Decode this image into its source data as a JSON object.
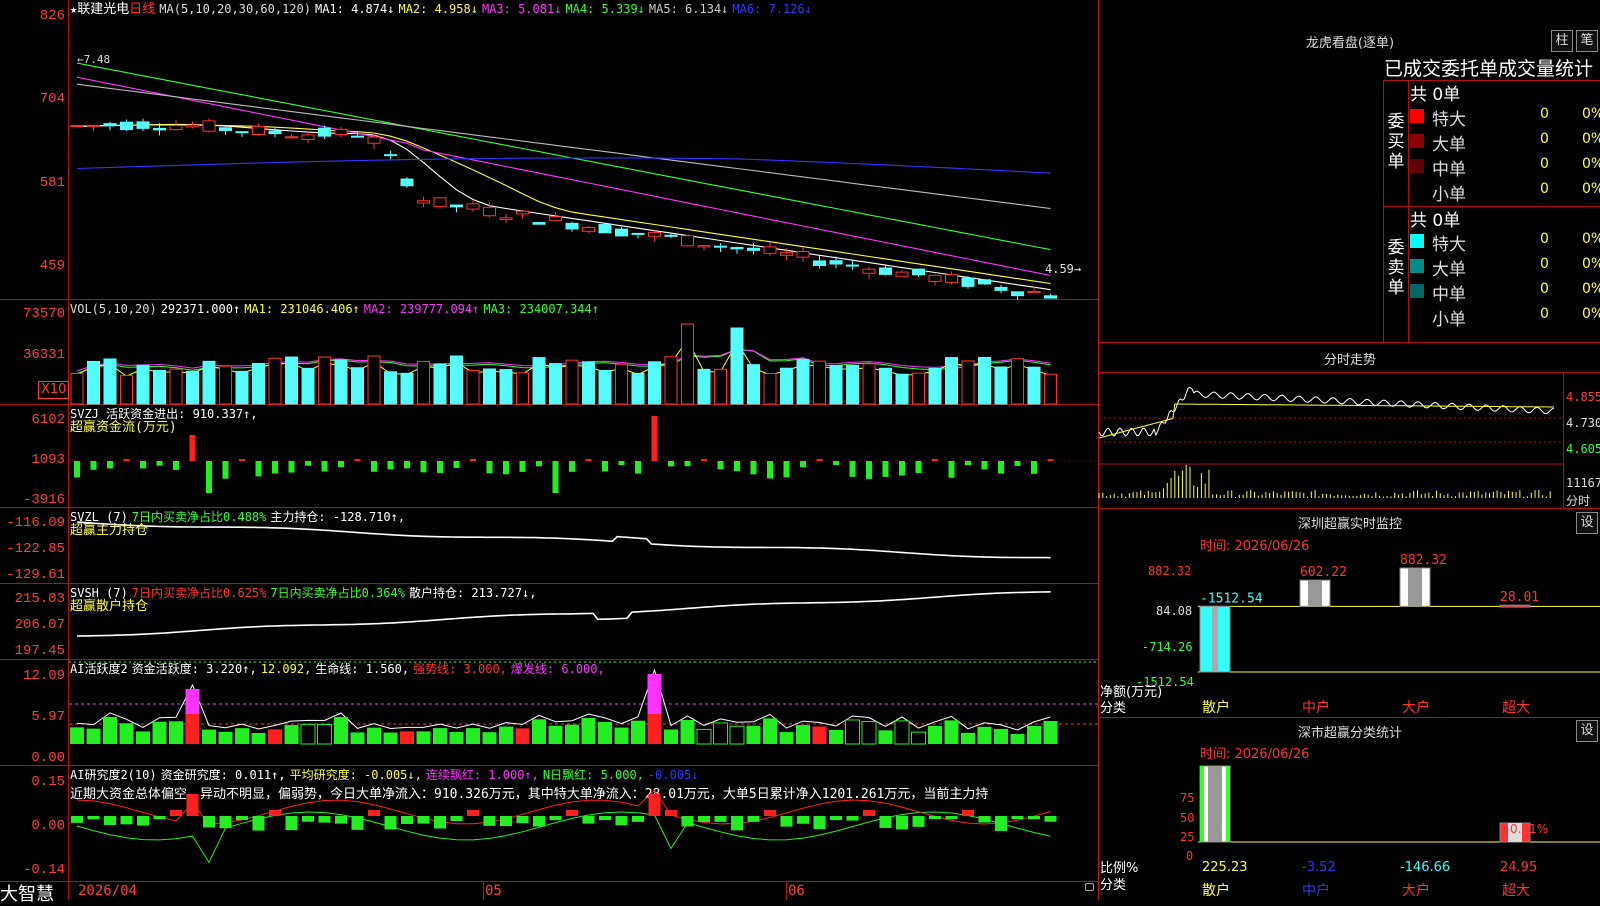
{
  "header": {
    "star": "★",
    "stock_name": "联建光电",
    "period": "日线",
    "ma_label": "MA(5,10,20,30,60,120)",
    "ma1": "MA1: 4.874↓",
    "ma2": "MA2: 4.958↓",
    "ma3": "MA3: 5.081↓",
    "ma4": "MA4: 5.339↓",
    "ma5": "MA5: 6.134↓",
    "ma6": "MA6: 7.126↓",
    "high_marker": "←7.48",
    "low_marker": "4.59→"
  },
  "price_axis": [
    "826",
    "704",
    "581",
    "459"
  ],
  "vol": {
    "label": "VOL(5,10,20)",
    "value": "292371.000↑",
    "ma1": "MA1: 231046.406↑",
    "ma2": "MA2: 239777.094↑",
    "ma3": "MA3: 234007.344↑",
    "axis": [
      "73570",
      "36331"
    ],
    "unit": "X10"
  },
  "svzj": {
    "title": "SVZJ  活跃资金进出: 910.337↑,",
    "subtitle": "超赢资金流(万元)",
    "axis": [
      "6102",
      "1093",
      "-3916"
    ]
  },
  "svzl": {
    "name": "SVZL (7)",
    "part1": "7日内买卖净占比0.488%",
    "part2": "主力持仓: -128.710↑,",
    "subtitle": "超赢主力持仓",
    "axis": [
      "-116.09",
      "-122.85",
      "-129.61"
    ]
  },
  "svsh": {
    "name": "SVSH (7)",
    "part1": "7日内买卖净占比0.625%",
    "part2": "7日内买卖净占比0.364%",
    "part3": "散户持仓: 213.727↓,",
    "subtitle": "超赢散户持仓",
    "axis": [
      "215.03",
      "206.07",
      "197.45"
    ]
  },
  "ai_active": {
    "name": "AI活跃度2",
    "p1": "资金活跃度: 3.220↑,",
    "p2": "12.092,",
    "p3": "生命线: 1.560,",
    "p4": "强势线: 3.000,",
    "p5": "爆发线: 6.000,",
    "axis": [
      "12.09",
      "5.97",
      "0.00"
    ]
  },
  "ai_research": {
    "name": "AI研究度2(10)",
    "p1": "资金研究度: 0.011↑,",
    "p2": "平均研究度: -0.005↓,",
    "p3": "连续飘红: 1.000↑,",
    "p4": "N日飘红: 5.000,",
    "p5": "-0.005↓",
    "comment": "近期大资金总体偏空，异动不明显，偏弱势，今日大单净流入：910.326万元，其中特大单净流入：28.01万元，大单5日累计净入1201.261万元，当前主力持",
    "axis": [
      "0.15",
      "0.00",
      "-0.14"
    ]
  },
  "footer": {
    "brand": "大智慧",
    "date_start": "2026/04",
    "month2": "05",
    "month3": "06"
  },
  "dragon": {
    "title": "龙虎看盘(逐单)",
    "btn1": "柱",
    "btn2": "笔",
    "tabs": "已成交委托单成交量统计",
    "buy_label": "委买单",
    "sell_label": "委卖单",
    "buy_total": "共 0单",
    "sell_total": "共 0单",
    "buy_rows": [
      {
        "label": "特大",
        "count": "0",
        "pct": "0%",
        "color": "#ff0000"
      },
      {
        "label": "大单",
        "count": "0",
        "pct": "0%",
        "color": "#8b0000"
      },
      {
        "label": "中单",
        "count": "0",
        "pct": "0%",
        "color": "#600000"
      },
      {
        "label": "小单",
        "count": "0",
        "pct": "0%",
        "color": "#000000"
      }
    ],
    "sell_rows": [
      {
        "label": "特大",
        "count": "0",
        "pct": "0%",
        "color": "#00ffff"
      },
      {
        "label": "大单",
        "count": "0",
        "pct": "0%",
        "color": "#008b8b"
      },
      {
        "label": "中单",
        "count": "0",
        "pct": "0%",
        "color": "#006666"
      },
      {
        "label": "小单",
        "count": "0",
        "pct": "0%",
        "color": "#000000"
      }
    ]
  },
  "intraday": {
    "title": "分时走势",
    "axis": [
      "4.855",
      "4.730",
      "4.605"
    ],
    "vol_top": "11167",
    "vol_unit": "分时"
  },
  "sz_monitor": {
    "title": "深圳超赢实时监控",
    "btn": "设",
    "time": "时间: 2026/06/26",
    "axis": [
      "882.32",
      "84.08",
      "-714.26",
      "-1512.54"
    ],
    "y_unit": "净额(万元)",
    "x_unit": "分类",
    "bars": [
      {
        "label": "散户",
        "value": -1512.54,
        "text": "-1512.54"
      },
      {
        "label": "中户",
        "value": 602.22,
        "text": "602.22"
      },
      {
        "label": "大户",
        "value": 882.32,
        "text": "882.32"
      },
      {
        "label": "超大",
        "value": 28.01,
        "text": "28.01"
      }
    ]
  },
  "sz_class": {
    "title": "深市超赢分类统计",
    "btn": "设",
    "time": "时间: 2026/06/26",
    "axis": [
      "75",
      "50",
      "25",
      "0"
    ],
    "y_unit": "比例%",
    "x_unit": "分类",
    "bars": [
      {
        "label": "散户",
        "value": 225.23,
        "text": "225.23"
      },
      {
        "label": "中户",
        "value": -3.52,
        "text": "-3.52"
      },
      {
        "label": "大户",
        "value": -146.66,
        "text": "-146.66"
      },
      {
        "label": "超大",
        "value": 24.95,
        "text": "24.95",
        "extra": "+0.01%"
      }
    ]
  },
  "colors": {
    "up": "#ff3232",
    "down": "#54fcfc",
    "axis": "#ff3c3c",
    "grid": "#b01010"
  }
}
